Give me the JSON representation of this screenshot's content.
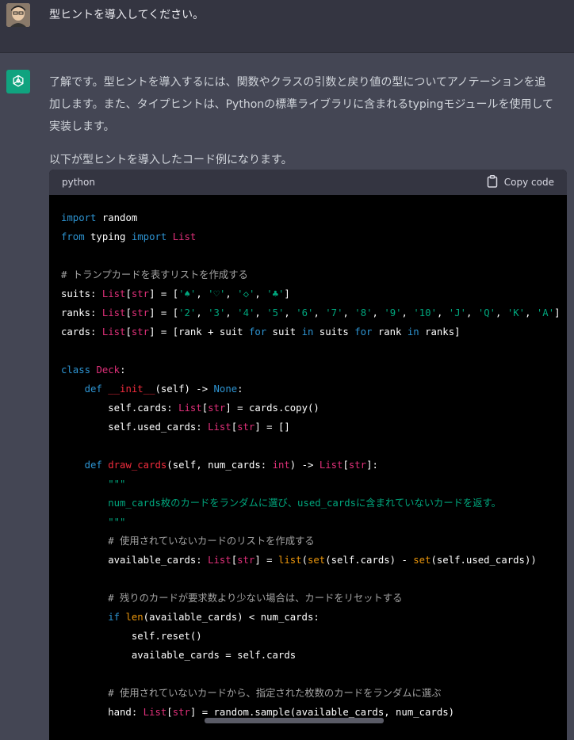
{
  "user": {
    "message": "型ヒントを導入してください。"
  },
  "assistant": {
    "paragraphs": [
      "了解です。型ヒントを導入するには、関数やクラスの引数と戻り値の型についてアノテーションを追加します。また、タイプヒントは、Pythonの標準ライブラリに含まれるtypingモジュールを使用して実装します。",
      "以下が型ヒントを導入したコード例になります。"
    ],
    "code_block": {
      "language": "python",
      "copy_label": "Copy code",
      "lines": [
        "import random",
        "from typing import List",
        "",
        "# トランプカードを表すリストを作成する",
        "suits: List[str] = ['♠', '♡', '◇', '♣']",
        "ranks: List[str] = ['2', '3', '4', '5', '6', '7', '8', '9', '10', 'J', 'Q', 'K', 'A']",
        "cards: List[str] = [rank + suit for suit in suits for rank in ranks]",
        "",
        "class Deck:",
        "    def __init__(self) -> None:",
        "        self.cards: List[str] = cards.copy()",
        "        self.used_cards: List[str] = []",
        "",
        "    def draw_cards(self, num_cards: int) -> List[str]:",
        "        \"\"\"",
        "        num_cards枚のカードをランダムに選び、used_cardsに含まれていないカードを返す。",
        "        \"\"\"",
        "        # 使用されていないカードのリストを作成する",
        "        available_cards: List[str] = list(set(self.cards) - set(self.used_cards))",
        "",
        "        # 残りのカードが要求数より少ない場合は、カードをリセットする",
        "        if len(available_cards) < num_cards:",
        "            self.reset()",
        "            available_cards = self.cards",
        "",
        "        # 使用されていないカードから、指定された枚数のカードをランダムに選ぶ",
        "        hand: List[str] = random.sample(available_cards, num_cards)"
      ]
    }
  }
}
